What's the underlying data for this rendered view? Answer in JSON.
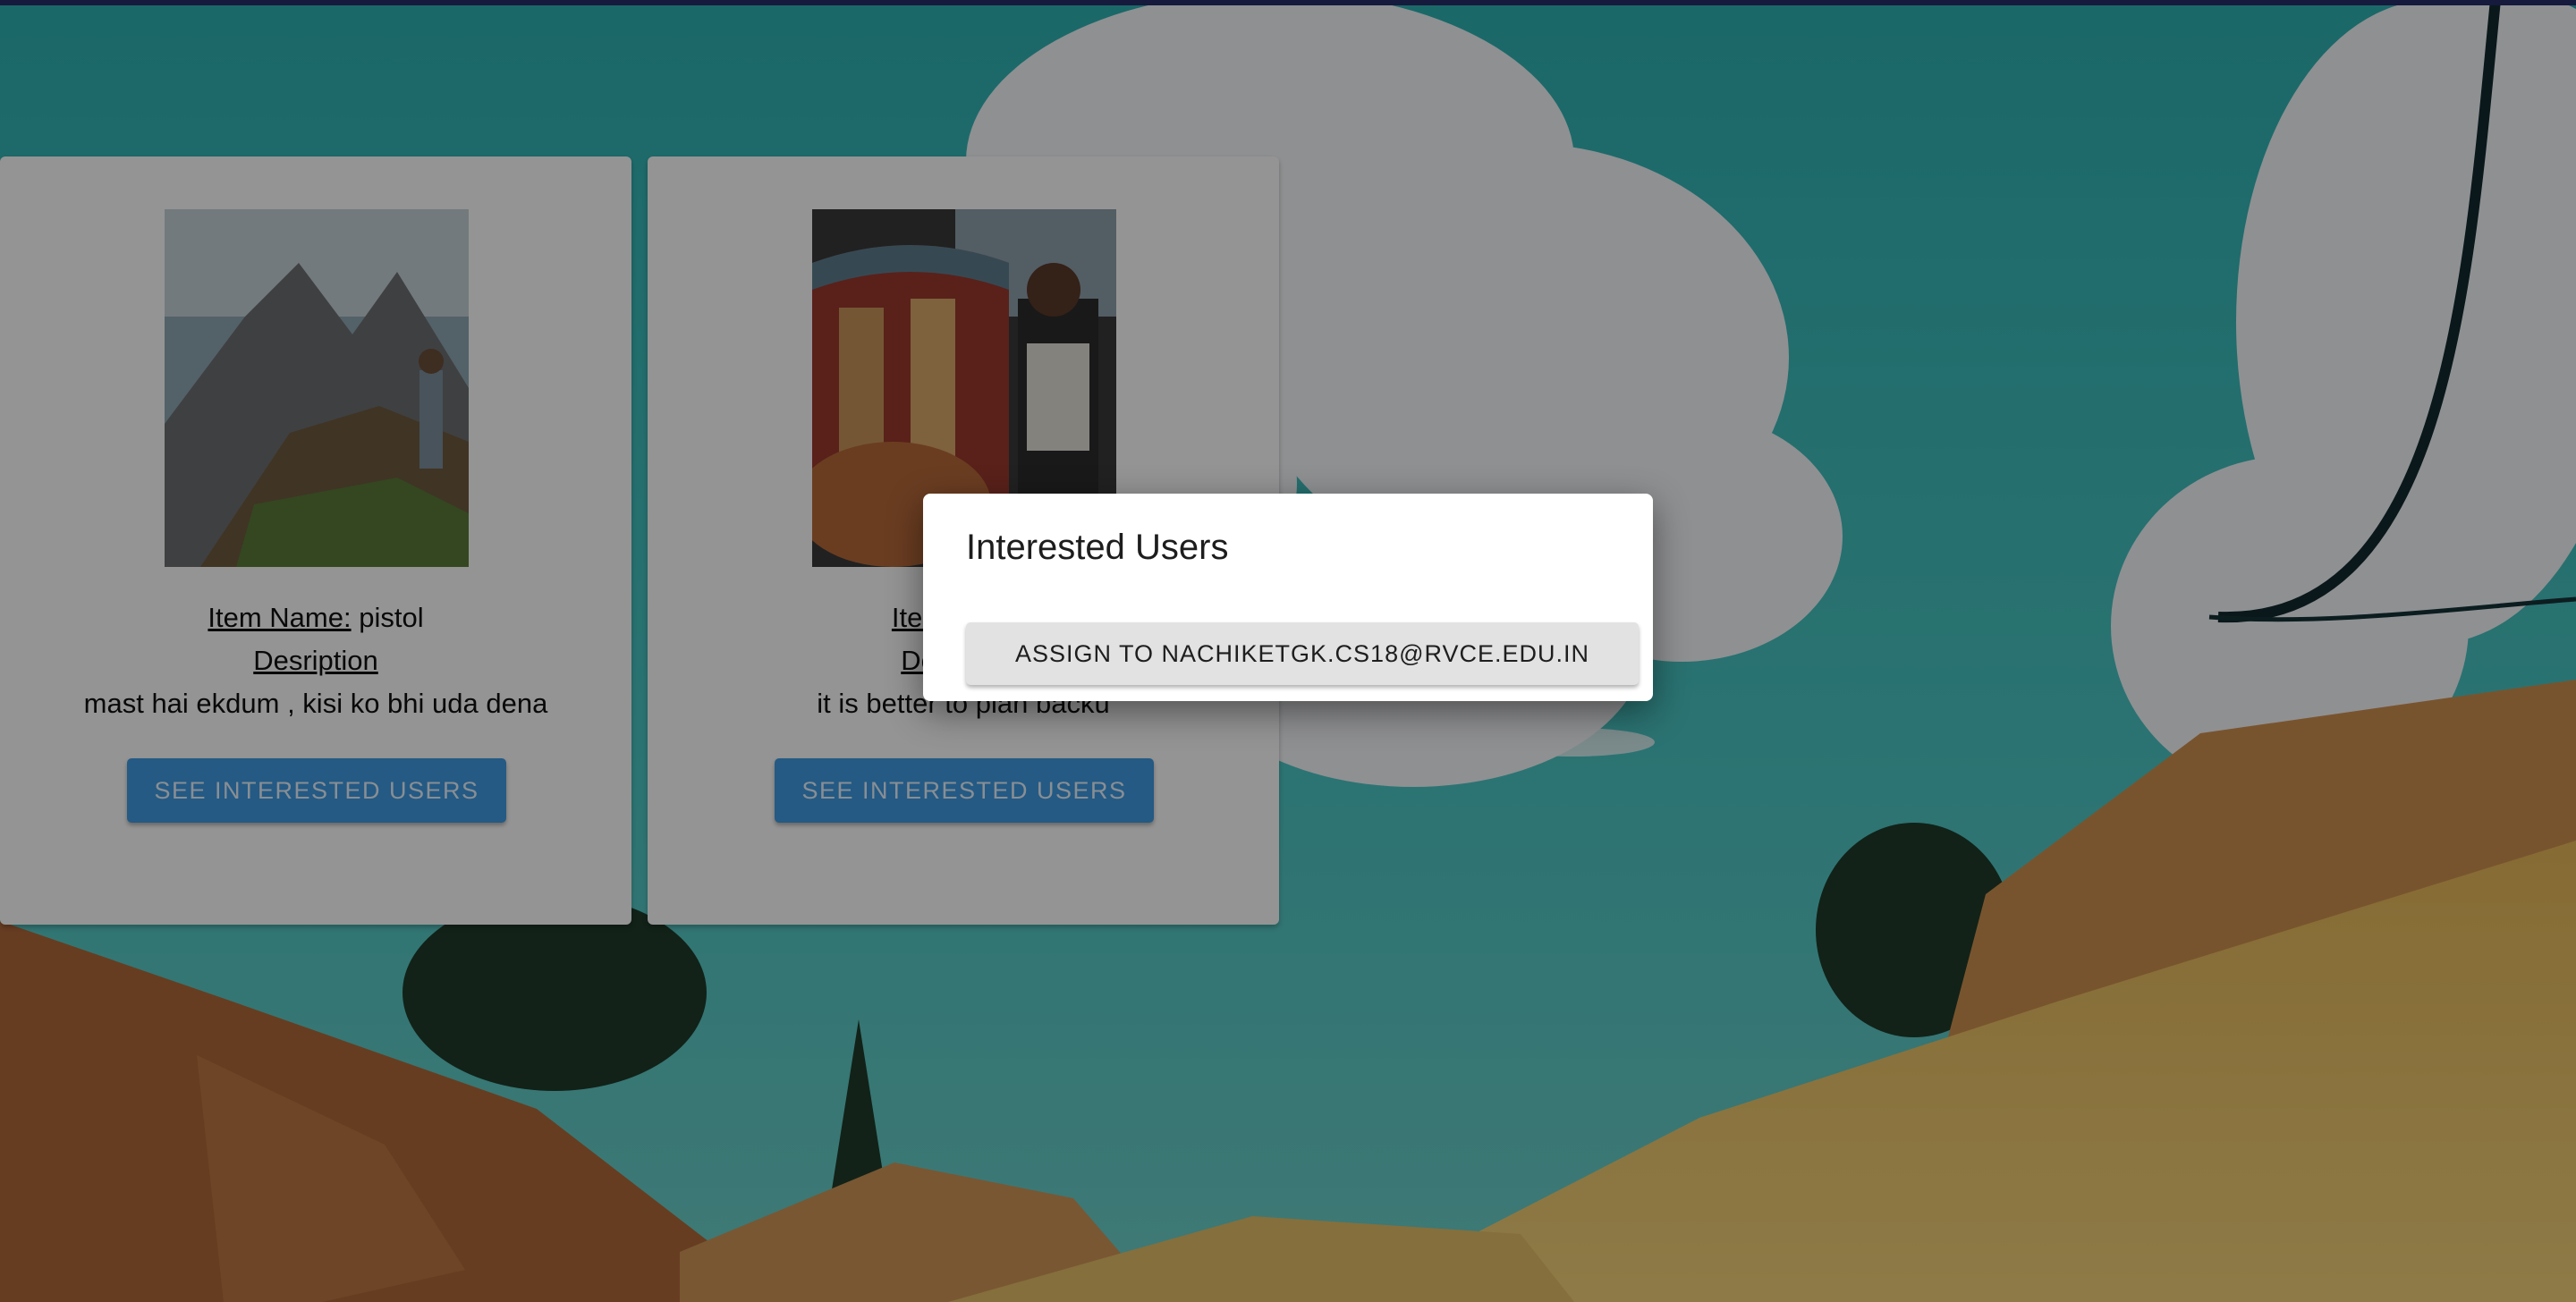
{
  "cards": [
    {
      "photo_icon": "mountain-hiker-photo",
      "item_name_label": "Item Name:",
      "item_name_value": " pistol",
      "description_label": "Desription",
      "description_value": "mast hai ekdum , kisi ko bhi uda dena",
      "button_label": "SEE INTERESTED USERS"
    },
    {
      "photo_icon": "food-vendor-photo",
      "item_name_label": "Item Name:",
      "item_name_value": "",
      "description_label": "Desription",
      "description_value": "it is better to plan backu",
      "button_label": "SEE INTERESTED USERS"
    }
  ],
  "dialog": {
    "title": "Interested Users",
    "assign_button_label": "ASSIGN TO NACHIKETGK.CS18@RVCE.EDU.IN"
  },
  "colors": {
    "top_bar": "#272d6a",
    "primary_button": "#3f9be3",
    "sky": "#3ec0bd",
    "grass": "#f0c65a"
  }
}
